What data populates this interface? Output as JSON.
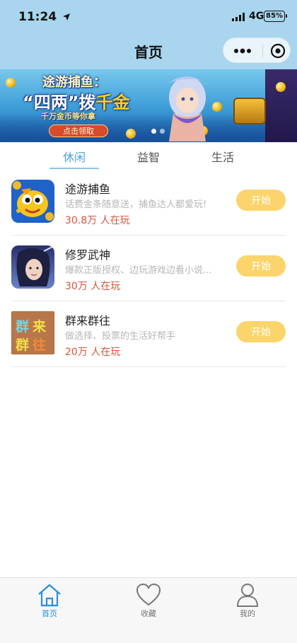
{
  "status_bar": {
    "time": "11:24",
    "network": "4G",
    "battery": "85%"
  },
  "nav": {
    "title": "首页",
    "more_icon": "more-dots-icon",
    "close_icon": "target-circle-icon"
  },
  "banner": {
    "line1": "途游捕鱼：",
    "line2_prefix": "“四两”拨",
    "line2_gold": "千金",
    "line3": "千万金币等你拿",
    "button_label": "点击领取",
    "dots": 2,
    "active_dot": 0
  },
  "tabs": [
    {
      "label": "休闲",
      "active": true
    },
    {
      "label": "益智",
      "active": false
    },
    {
      "label": "生活",
      "active": false
    }
  ],
  "games": [
    {
      "name": "途游捕鱼",
      "desc": "话费金条随意送，捕鱼达人都爱玩!",
      "players": "30.8万 人在玩",
      "button": "开始",
      "icon": "fish-game-icon"
    },
    {
      "name": "修罗武神",
      "desc": "爆款正版授权、边玩游戏边看小说...",
      "players": "30万 人在玩",
      "button": "开始",
      "icon": "warrior-game-icon"
    },
    {
      "name": "群来群往",
      "desc": "做选择、投票的生活好帮手",
      "players": "20万 人在玩",
      "button": "开始",
      "icon": "group-app-icon",
      "icon_text": "群来群往"
    }
  ],
  "bottom_nav": [
    {
      "label": "首页",
      "icon": "home-icon",
      "active": true
    },
    {
      "label": "收藏",
      "icon": "heart-icon",
      "active": false
    },
    {
      "label": "我的",
      "icon": "user-icon",
      "active": false
    }
  ],
  "colors": {
    "header_bg": "#a9d5ee",
    "accent": "#4da3d9",
    "start_button": "#fbd56b",
    "players_text": "#d6573c",
    "nav_active": "#2a8fe0"
  }
}
